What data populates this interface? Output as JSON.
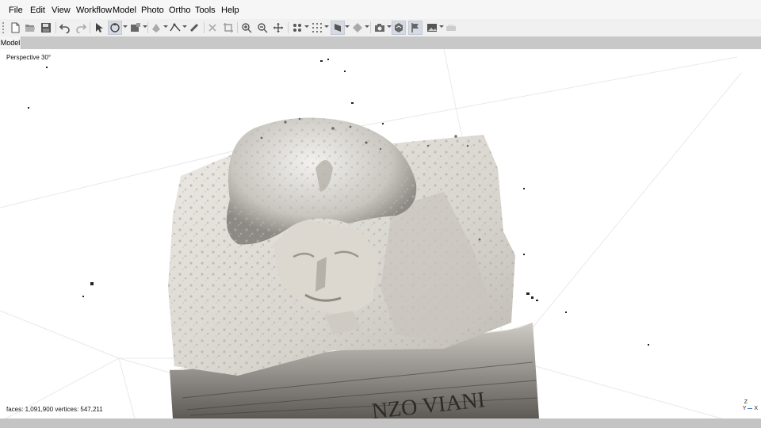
{
  "menu": [
    "File",
    "Edit",
    "View",
    "Workflow",
    "Model",
    "Photo",
    "Ortho",
    "Tools",
    "Help"
  ],
  "toolbar_icons": [
    "new-file-icon",
    "open-folder-icon",
    "save-icon",
    "undo-icon",
    "redo-icon",
    "select-arrow-icon",
    "navigation-icon",
    "selection-shape-icon",
    "tool-icon",
    "ruler-icon",
    "polyline-icon",
    "measure-icon",
    "delete-icon",
    "crop-icon",
    "zoom-in-icon",
    "zoom-out-icon",
    "reset-view-icon",
    "points-icon",
    "grid-icon",
    "model-view-icon",
    "shaded-icon",
    "camera-icon",
    "markers-icon",
    "flag-icon",
    "image-icon",
    "region-icon"
  ],
  "tab": {
    "label": "Model"
  },
  "viewport": {
    "projection": "Perspective 30°",
    "stats": "faces: 1,091,900 vertices: 547,211",
    "inscription": "NZO VIANI",
    "axis_z": "Z",
    "axis_y": "Y",
    "axis_x": "X"
  },
  "colors": {
    "background": "#ffffff",
    "accent": "#3a78c7",
    "stone": "#d9d7d2"
  }
}
